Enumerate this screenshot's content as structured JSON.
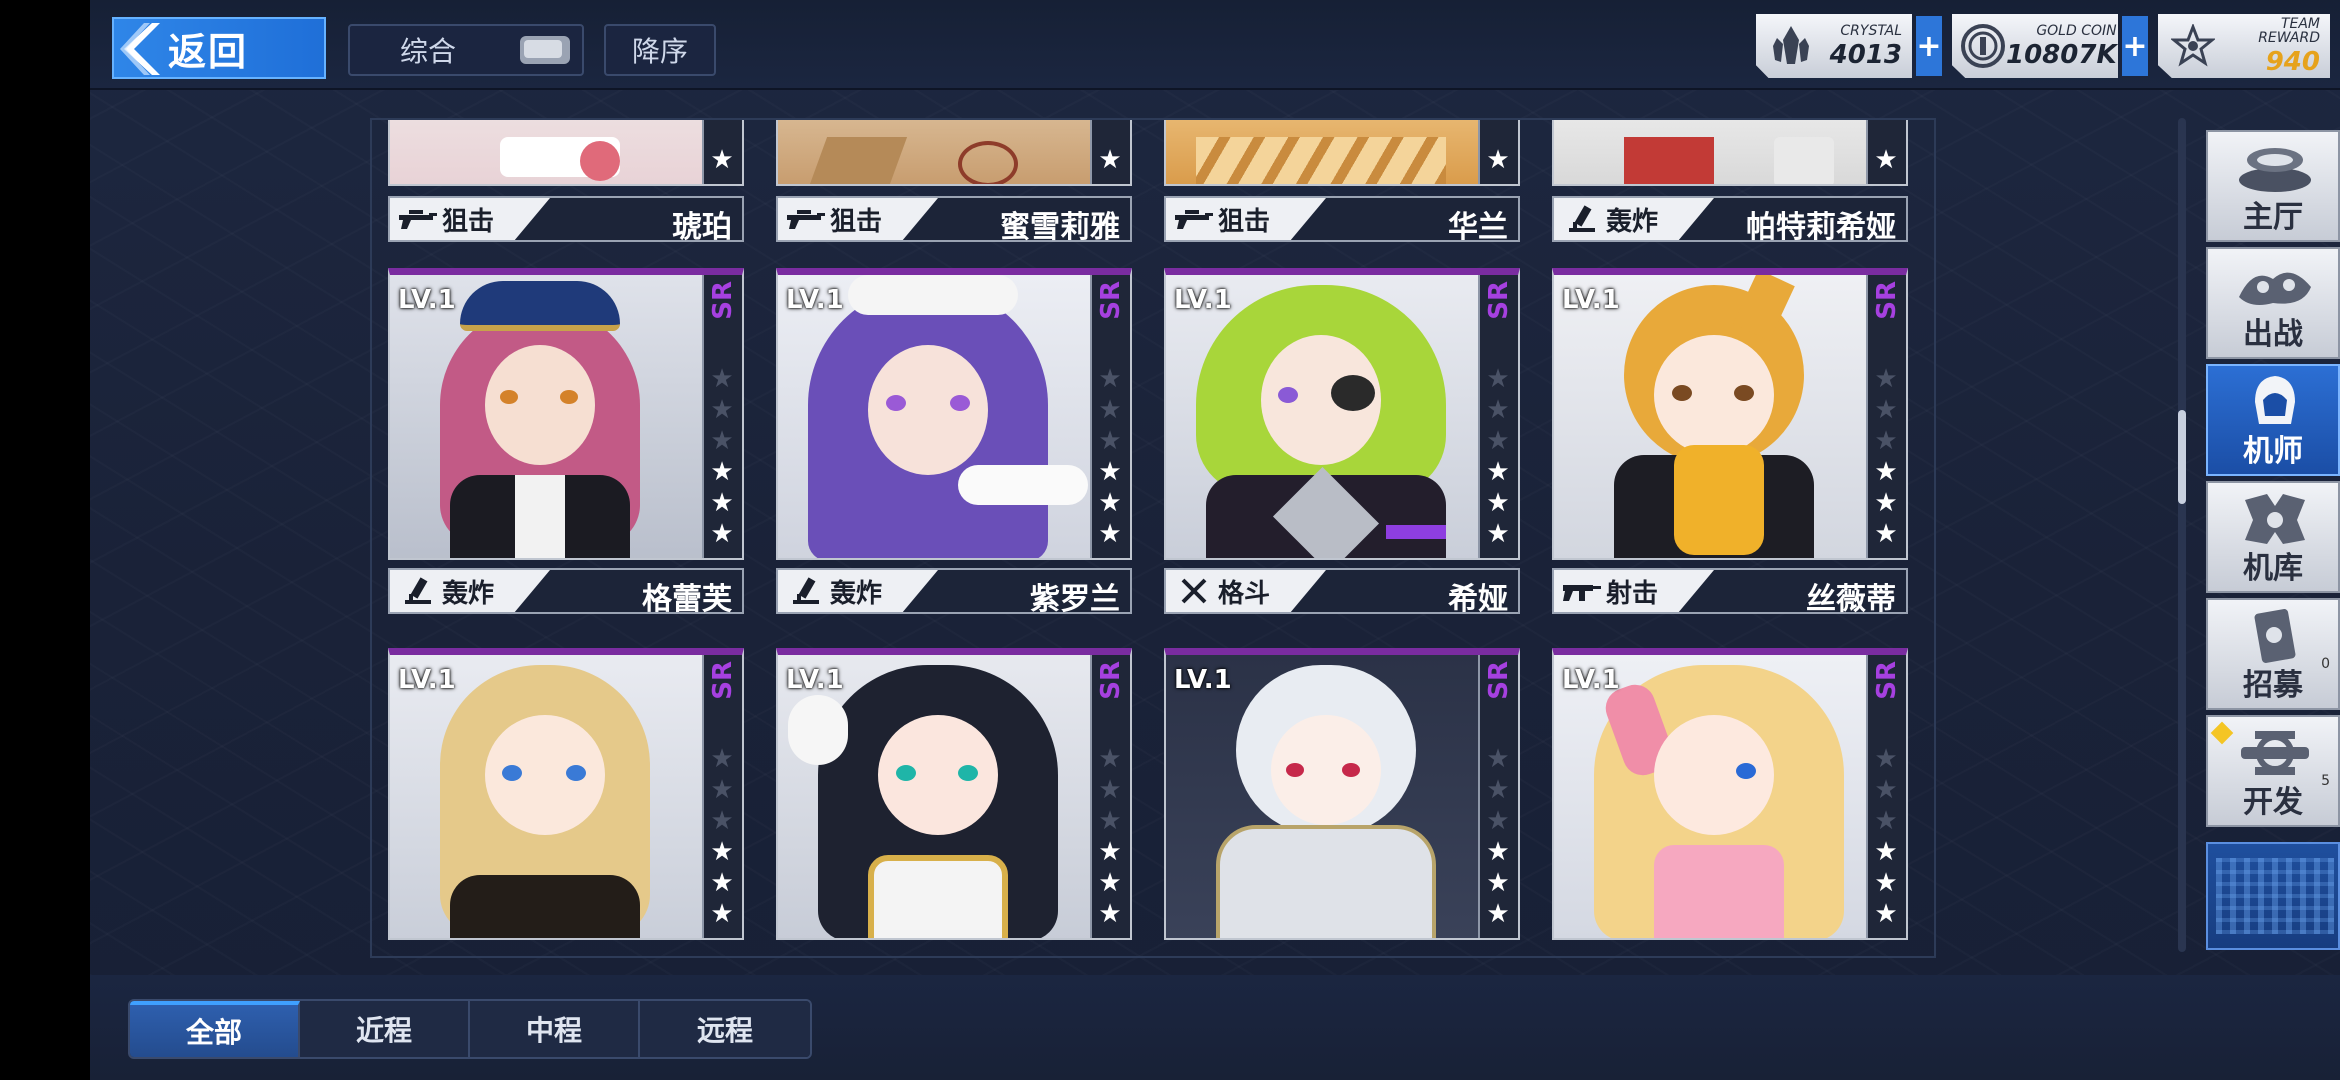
{
  "header": {
    "back_label": "返回",
    "sort_label": "综合",
    "order_label": "降序"
  },
  "currencies": [
    {
      "caption": "CRYSTAL",
      "value": "4013",
      "icon": "crystal-icon"
    },
    {
      "caption": "GOLD COIN",
      "value": "10807K",
      "icon": "gold-coin-icon"
    },
    {
      "caption": "TEAM REWARD",
      "value": "940",
      "icon": "team-reward-icon"
    }
  ],
  "cards_top": [
    {
      "class": "狙击",
      "name": "琥珀",
      "weapon": "sniper-rifle-icon"
    },
    {
      "class": "狙击",
      "name": "蜜雪莉雅",
      "weapon": "sniper-rifle-icon"
    },
    {
      "class": "狙击",
      "name": "华兰",
      "weapon": "sniper-rifle-icon"
    },
    {
      "class": "轰炸",
      "name": "帕特莉希娅",
      "weapon": "bomb-launcher-icon"
    }
  ],
  "cards_mid": [
    {
      "class": "轰炸",
      "name": "格蕾芙",
      "level": "LV.1",
      "rarity": "SR",
      "stars": 3,
      "weapon": "bomb-launcher-icon",
      "hair": "#c25a86"
    },
    {
      "class": "轰炸",
      "name": "紫罗兰",
      "level": "LV.1",
      "rarity": "SR",
      "stars": 3,
      "weapon": "bomb-launcher-icon",
      "hair": "#6a4fb8"
    },
    {
      "class": "格斗",
      "name": "希娅",
      "level": "LV.1",
      "rarity": "SR",
      "stars": 3,
      "weapon": "crossed-swords-icon",
      "hair": "#a8d63a"
    },
    {
      "class": "射击",
      "name": "丝薇蒂",
      "level": "LV.1",
      "rarity": "SR",
      "stars": 3,
      "weapon": "rifle-icon",
      "hair": "#e8a93a"
    }
  ],
  "cards_bottom": [
    {
      "level": "LV.1",
      "rarity": "SR",
      "stars": 3,
      "hair": "#e5c98a"
    },
    {
      "level": "LV.1",
      "rarity": "SR",
      "stars": 3,
      "hair": "#1e2230"
    },
    {
      "level": "LV.1",
      "rarity": "SR",
      "stars": 3,
      "hair": "#e8ecf2"
    },
    {
      "level": "LV.1",
      "rarity": "SR",
      "stars": 3,
      "hair": "#f3d38a"
    }
  ],
  "nav": [
    {
      "label": "主厅",
      "icon": "lobby-icon"
    },
    {
      "label": "出战",
      "icon": "sortie-icon"
    },
    {
      "label": "机师",
      "icon": "pilot-icon"
    },
    {
      "label": "机库",
      "icon": "hangar-icon"
    },
    {
      "label": "招募",
      "icon": "recruit-icon",
      "badge": "0"
    },
    {
      "label": "开发",
      "icon": "develop-icon",
      "badge": "5"
    }
  ],
  "tabs": [
    {
      "label": "全部"
    },
    {
      "label": "近程"
    },
    {
      "label": "中程"
    },
    {
      "label": "远程"
    }
  ],
  "colors": {
    "accent": "#2f86e8",
    "rarity_sr": "#a640e0",
    "team_reward": "#e6a21c"
  }
}
